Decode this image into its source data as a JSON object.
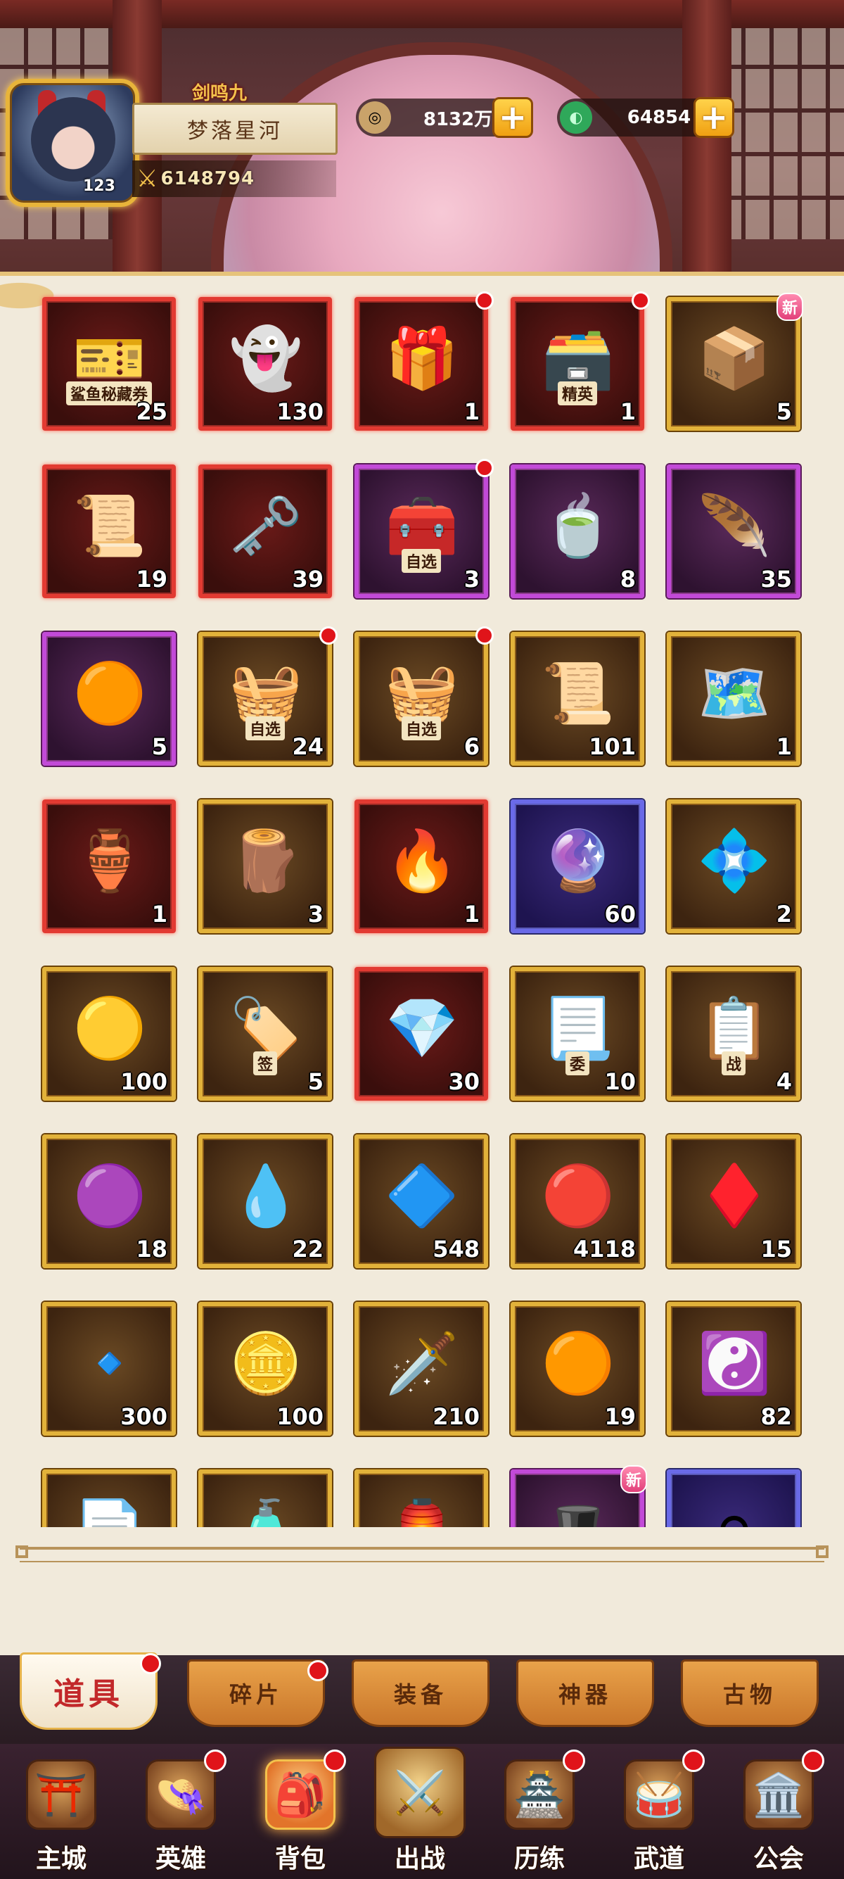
{
  "player": {
    "name": "梦落星河",
    "level": "123",
    "power": "6148794",
    "game_logo": "剑鸣九霄"
  },
  "currencies": [
    {
      "name": "copper-coin",
      "icon": "coin-icon",
      "value": "8132万",
      "color": "#c9a36a"
    },
    {
      "name": "jade",
      "icon": "jade-icon",
      "value": "64854",
      "color": "#3fbf6a"
    }
  ],
  "items": [
    {
      "label": "鲨鱼秘藏券",
      "glyph": "🎫",
      "count": "25",
      "rarity": "red",
      "dot": false,
      "new": false
    },
    {
      "label": "",
      "glyph": "👻",
      "count": "130",
      "rarity": "red",
      "dot": false,
      "new": false
    },
    {
      "label": "",
      "glyph": "🎁",
      "count": "1",
      "rarity": "red",
      "dot": true,
      "new": false
    },
    {
      "label": "精英",
      "glyph": "🗃️",
      "count": "1",
      "rarity": "red",
      "dot": true,
      "new": false
    },
    {
      "label": "",
      "glyph": "📦",
      "count": "5",
      "rarity": "gold",
      "dot": true,
      "new": true
    },
    {
      "label": "",
      "glyph": "📜",
      "count": "19",
      "rarity": "red",
      "dot": false,
      "new": false
    },
    {
      "label": "",
      "glyph": "🗝️",
      "count": "39",
      "rarity": "red",
      "dot": false,
      "new": false
    },
    {
      "label": "自选",
      "glyph": "🧰",
      "count": "3",
      "rarity": "purple",
      "dot": true,
      "new": false
    },
    {
      "label": "",
      "glyph": "🍵",
      "count": "8",
      "rarity": "purple",
      "dot": false,
      "new": false
    },
    {
      "label": "",
      "glyph": "🪶",
      "count": "35",
      "rarity": "purple",
      "dot": false,
      "new": false
    },
    {
      "label": "",
      "glyph": "🟠",
      "count": "5",
      "rarity": "purple",
      "dot": false,
      "new": false
    },
    {
      "label": "自选",
      "glyph": "🧺",
      "count": "24",
      "rarity": "gold",
      "dot": true,
      "new": false
    },
    {
      "label": "自选",
      "glyph": "🧺",
      "count": "6",
      "rarity": "gold",
      "dot": true,
      "new": false
    },
    {
      "label": "",
      "glyph": "📜",
      "count": "101",
      "rarity": "gold",
      "dot": false,
      "new": false
    },
    {
      "label": "",
      "glyph": "🗺️",
      "count": "1",
      "rarity": "gold",
      "dot": false,
      "new": false
    },
    {
      "label": "",
      "glyph": "🏺",
      "count": "1",
      "rarity": "red",
      "dot": false,
      "new": false
    },
    {
      "label": "",
      "glyph": "🪵",
      "count": "3",
      "rarity": "gold",
      "dot": false,
      "new": false
    },
    {
      "label": "",
      "glyph": "🔥",
      "count": "1",
      "rarity": "red",
      "dot": false,
      "new": false
    },
    {
      "label": "",
      "glyph": "🔮",
      "count": "60",
      "rarity": "blue",
      "dot": false,
      "new": false
    },
    {
      "label": "",
      "glyph": "💠",
      "count": "2",
      "rarity": "gold",
      "dot": false,
      "new": false
    },
    {
      "label": "",
      "glyph": "🟡",
      "count": "100",
      "rarity": "gold",
      "dot": false,
      "new": false
    },
    {
      "label": "签",
      "glyph": "🏷️",
      "count": "5",
      "rarity": "gold",
      "dot": false,
      "new": false
    },
    {
      "label": "",
      "glyph": "💎",
      "count": "30",
      "rarity": "red",
      "dot": false,
      "new": false
    },
    {
      "label": "委",
      "glyph": "📃",
      "count": "10",
      "rarity": "gold",
      "dot": false,
      "new": false
    },
    {
      "label": "战",
      "glyph": "📋",
      "count": "4",
      "rarity": "gold",
      "dot": false,
      "new": false
    },
    {
      "label": "",
      "glyph": "🟣",
      "count": "18",
      "rarity": "gold",
      "dot": false,
      "new": false
    },
    {
      "label": "",
      "glyph": "💧",
      "count": "22",
      "rarity": "gold",
      "dot": false,
      "new": false
    },
    {
      "label": "",
      "glyph": "🔷",
      "count": "548",
      "rarity": "gold",
      "dot": false,
      "new": false
    },
    {
      "label": "",
      "glyph": "🔴",
      "count": "4118",
      "rarity": "gold",
      "dot": false,
      "new": false
    },
    {
      "label": "",
      "glyph": "♦️",
      "count": "15",
      "rarity": "gold",
      "dot": false,
      "new": false
    },
    {
      "label": "",
      "glyph": "🔹",
      "count": "300",
      "rarity": "gold",
      "dot": false,
      "new": false
    },
    {
      "label": "",
      "glyph": "🪙",
      "count": "100",
      "rarity": "gold",
      "dot": false,
      "new": false
    },
    {
      "label": "",
      "glyph": "🗡️",
      "count": "210",
      "rarity": "gold",
      "dot": false,
      "new": false
    },
    {
      "label": "",
      "glyph": "🟠",
      "count": "19",
      "rarity": "gold",
      "dot": false,
      "new": false
    },
    {
      "label": "",
      "glyph": "☯️",
      "count": "82",
      "rarity": "gold",
      "dot": false,
      "new": false
    },
    {
      "label": "",
      "glyph": "📄",
      "count": "",
      "rarity": "gold",
      "dot": false,
      "new": false
    },
    {
      "label": "",
      "glyph": "🧴",
      "count": "",
      "rarity": "gold",
      "dot": false,
      "new": false
    },
    {
      "label": "",
      "glyph": "🏮",
      "count": "",
      "rarity": "gold",
      "dot": false,
      "new": false
    },
    {
      "label": "",
      "glyph": "🎩",
      "count": "",
      "rarity": "purple",
      "dot": true,
      "new": true
    },
    {
      "label": "",
      "glyph": "⚪",
      "count": "",
      "rarity": "blue",
      "dot": false,
      "new": false
    }
  ],
  "new_badge_text": "新",
  "tabs": [
    {
      "label": "道具",
      "active": true,
      "dot": true
    },
    {
      "label": "碎片",
      "active": false,
      "dot": true
    },
    {
      "label": "装备",
      "active": false,
      "dot": false
    },
    {
      "label": "神器",
      "active": false,
      "dot": false
    },
    {
      "label": "古物",
      "active": false,
      "dot": false
    }
  ],
  "nav": [
    {
      "label": "主城",
      "icon": "city-gate-icon",
      "glyph": "⛩️",
      "active": false,
      "dot": false
    },
    {
      "label": "英雄",
      "icon": "hero-hat-icon",
      "glyph": "👒",
      "active": false,
      "dot": true
    },
    {
      "label": "背包",
      "icon": "backpack-icon",
      "glyph": "🎒",
      "active": true,
      "dot": true
    },
    {
      "label": "出战",
      "icon": "crossed-swords-icon",
      "glyph": "⚔️",
      "active": false,
      "dot": false
    },
    {
      "label": "历练",
      "icon": "training-icon",
      "glyph": "🏯",
      "active": false,
      "dot": true
    },
    {
      "label": "武道",
      "icon": "drum-icon",
      "glyph": "🥁",
      "active": false,
      "dot": true
    },
    {
      "label": "公会",
      "icon": "guild-icon",
      "glyph": "🏛️",
      "active": false,
      "dot": true
    }
  ]
}
